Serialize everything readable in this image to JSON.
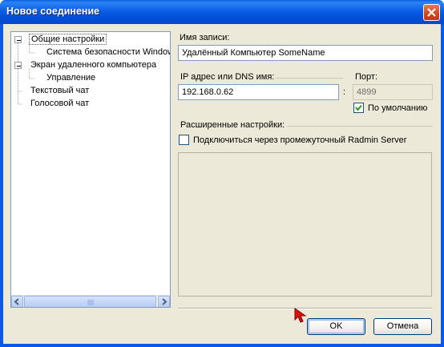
{
  "window": {
    "title": "Новое соединение"
  },
  "tree": {
    "items": [
      {
        "label": "Общие настройки",
        "selected": true,
        "expanded": true
      },
      {
        "label": "Система безопасности Windows",
        "level": 2
      },
      {
        "label": "Экран удаленного компьютера",
        "expanded": true
      },
      {
        "label": "Управление",
        "level": 2
      },
      {
        "label": "Текстовый чат"
      },
      {
        "label": "Голосовой чат"
      }
    ]
  },
  "form": {
    "record_name_label": "Имя записи:",
    "record_name_value": "Удалённый Компьютер SomeName",
    "ip_label": "IP адрес или DNS имя:",
    "ip_value": "192.168.0.62",
    "colon": ":",
    "port_label": "Порт:",
    "port_value": "4899",
    "default_checkbox_label": "По умолчанию",
    "default_checked": true,
    "advanced_label": "Расширенные настройки:",
    "intermediate_checkbox_label": "Подключиться через промежуточный Radmin Server",
    "intermediate_checked": false
  },
  "buttons": {
    "ok": "OK",
    "cancel": "Отмена"
  },
  "colors": {
    "titlebar": "#0a58e8",
    "accent_check": "#21a121",
    "cursor": "#e01010"
  }
}
